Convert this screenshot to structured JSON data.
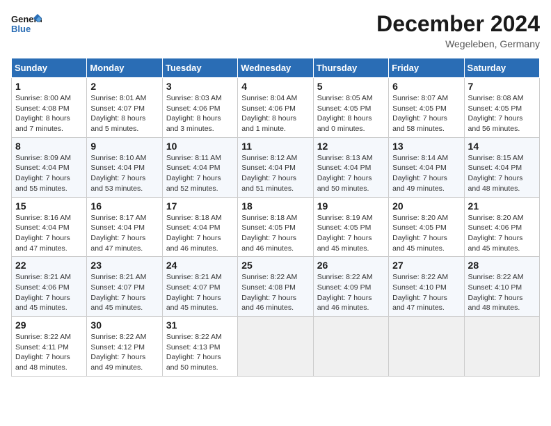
{
  "header": {
    "logo_general": "General",
    "logo_blue": "Blue",
    "month": "December 2024",
    "location": "Wegeleben, Germany"
  },
  "weekdays": [
    "Sunday",
    "Monday",
    "Tuesday",
    "Wednesday",
    "Thursday",
    "Friday",
    "Saturday"
  ],
  "weeks": [
    [
      {
        "day": "1",
        "info": "Sunrise: 8:00 AM\nSunset: 4:08 PM\nDaylight: 8 hours\nand 7 minutes."
      },
      {
        "day": "2",
        "info": "Sunrise: 8:01 AM\nSunset: 4:07 PM\nDaylight: 8 hours\nand 5 minutes."
      },
      {
        "day": "3",
        "info": "Sunrise: 8:03 AM\nSunset: 4:06 PM\nDaylight: 8 hours\nand 3 minutes."
      },
      {
        "day": "4",
        "info": "Sunrise: 8:04 AM\nSunset: 4:06 PM\nDaylight: 8 hours\nand 1 minute."
      },
      {
        "day": "5",
        "info": "Sunrise: 8:05 AM\nSunset: 4:05 PM\nDaylight: 8 hours\nand 0 minutes."
      },
      {
        "day": "6",
        "info": "Sunrise: 8:07 AM\nSunset: 4:05 PM\nDaylight: 7 hours\nand 58 minutes."
      },
      {
        "day": "7",
        "info": "Sunrise: 8:08 AM\nSunset: 4:05 PM\nDaylight: 7 hours\nand 56 minutes."
      }
    ],
    [
      {
        "day": "8",
        "info": "Sunrise: 8:09 AM\nSunset: 4:04 PM\nDaylight: 7 hours\nand 55 minutes."
      },
      {
        "day": "9",
        "info": "Sunrise: 8:10 AM\nSunset: 4:04 PM\nDaylight: 7 hours\nand 53 minutes."
      },
      {
        "day": "10",
        "info": "Sunrise: 8:11 AM\nSunset: 4:04 PM\nDaylight: 7 hours\nand 52 minutes."
      },
      {
        "day": "11",
        "info": "Sunrise: 8:12 AM\nSunset: 4:04 PM\nDaylight: 7 hours\nand 51 minutes."
      },
      {
        "day": "12",
        "info": "Sunrise: 8:13 AM\nSunset: 4:04 PM\nDaylight: 7 hours\nand 50 minutes."
      },
      {
        "day": "13",
        "info": "Sunrise: 8:14 AM\nSunset: 4:04 PM\nDaylight: 7 hours\nand 49 minutes."
      },
      {
        "day": "14",
        "info": "Sunrise: 8:15 AM\nSunset: 4:04 PM\nDaylight: 7 hours\nand 48 minutes."
      }
    ],
    [
      {
        "day": "15",
        "info": "Sunrise: 8:16 AM\nSunset: 4:04 PM\nDaylight: 7 hours\nand 47 minutes."
      },
      {
        "day": "16",
        "info": "Sunrise: 8:17 AM\nSunset: 4:04 PM\nDaylight: 7 hours\nand 47 minutes."
      },
      {
        "day": "17",
        "info": "Sunrise: 8:18 AM\nSunset: 4:04 PM\nDaylight: 7 hours\nand 46 minutes."
      },
      {
        "day": "18",
        "info": "Sunrise: 8:18 AM\nSunset: 4:05 PM\nDaylight: 7 hours\nand 46 minutes."
      },
      {
        "day": "19",
        "info": "Sunrise: 8:19 AM\nSunset: 4:05 PM\nDaylight: 7 hours\nand 45 minutes."
      },
      {
        "day": "20",
        "info": "Sunrise: 8:20 AM\nSunset: 4:05 PM\nDaylight: 7 hours\nand 45 minutes."
      },
      {
        "day": "21",
        "info": "Sunrise: 8:20 AM\nSunset: 4:06 PM\nDaylight: 7 hours\nand 45 minutes."
      }
    ],
    [
      {
        "day": "22",
        "info": "Sunrise: 8:21 AM\nSunset: 4:06 PM\nDaylight: 7 hours\nand 45 minutes."
      },
      {
        "day": "23",
        "info": "Sunrise: 8:21 AM\nSunset: 4:07 PM\nDaylight: 7 hours\nand 45 minutes."
      },
      {
        "day": "24",
        "info": "Sunrise: 8:21 AM\nSunset: 4:07 PM\nDaylight: 7 hours\nand 45 minutes."
      },
      {
        "day": "25",
        "info": "Sunrise: 8:22 AM\nSunset: 4:08 PM\nDaylight: 7 hours\nand 46 minutes."
      },
      {
        "day": "26",
        "info": "Sunrise: 8:22 AM\nSunset: 4:09 PM\nDaylight: 7 hours\nand 46 minutes."
      },
      {
        "day": "27",
        "info": "Sunrise: 8:22 AM\nSunset: 4:10 PM\nDaylight: 7 hours\nand 47 minutes."
      },
      {
        "day": "28",
        "info": "Sunrise: 8:22 AM\nSunset: 4:10 PM\nDaylight: 7 hours\nand 48 minutes."
      }
    ],
    [
      {
        "day": "29",
        "info": "Sunrise: 8:22 AM\nSunset: 4:11 PM\nDaylight: 7 hours\nand 48 minutes."
      },
      {
        "day": "30",
        "info": "Sunrise: 8:22 AM\nSunset: 4:12 PM\nDaylight: 7 hours\nand 49 minutes."
      },
      {
        "day": "31",
        "info": "Sunrise: 8:22 AM\nSunset: 4:13 PM\nDaylight: 7 hours\nand 50 minutes."
      },
      {
        "day": "",
        "info": ""
      },
      {
        "day": "",
        "info": ""
      },
      {
        "day": "",
        "info": ""
      },
      {
        "day": "",
        "info": ""
      }
    ]
  ]
}
